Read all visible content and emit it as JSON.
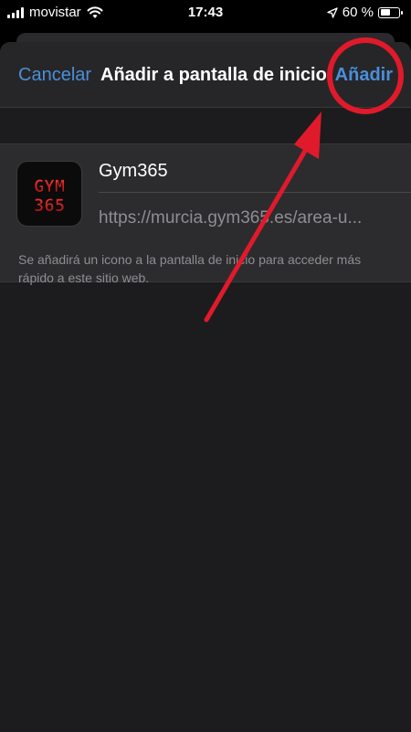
{
  "status_bar": {
    "carrier": "movistar",
    "time": "17:43",
    "battery_text": "60 %",
    "battery_level": 0.6,
    "signal_icon": "signal-bars-icon",
    "wifi_icon": "wifi-icon",
    "location_icon": "location-arrow-icon"
  },
  "nav": {
    "cancel_label": "Cancelar",
    "title": "Añadir a pantalla de inicio",
    "add_label": "Añadir"
  },
  "app": {
    "icon_line1": "GYM",
    "icon_line2": "365",
    "name": "Gym365",
    "url": "https://murcia.gym365.es/area-u..."
  },
  "footnote": "Se añadirá un icono a la pantalla de inicio para acceder más rápido a este sitio web.",
  "colors": {
    "accent": "#4b8fd9",
    "annotation": "#e01a2b",
    "background": "#1c1c1e"
  }
}
